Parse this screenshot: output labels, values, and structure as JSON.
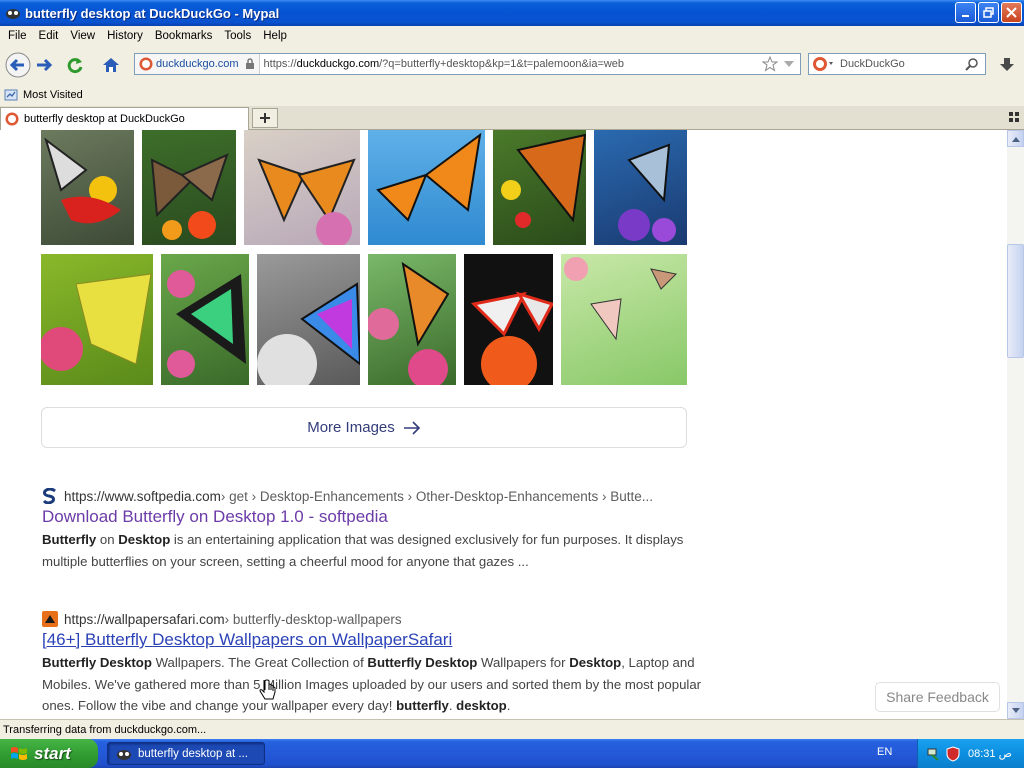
{
  "window": {
    "title": "butterfly desktop at DuckDuckGo - Mypal"
  },
  "menu": {
    "items": [
      {
        "label": "File"
      },
      {
        "label": "Edit"
      },
      {
        "label": "View"
      },
      {
        "label": "History"
      },
      {
        "label": "Bookmarks"
      },
      {
        "label": "Tools"
      },
      {
        "label": "Help"
      }
    ]
  },
  "navbar": {
    "site_domain": "duckduckgo.com",
    "url_scheme": "https://",
    "url_host": "duckduckgo.com",
    "url_rest": "/?q=butterfly+desktop&kp=1&t=palemoon&ia=web",
    "search_placeholder": "DuckDuckGo"
  },
  "bookmarks": {
    "most_visited": "Most Visited"
  },
  "tabs": {
    "active_label": "butterfly desktop at DuckDuckGo"
  },
  "content": {
    "more_images": "More Images",
    "results": [
      {
        "host": "https://www.softpedia.com",
        "path": " › get › Desktop-Enhancements › Other-Desktop-Enhancements › Butte...",
        "title": "Download Butterfly on Desktop 1.0 - softpedia",
        "snippet_b1": "Butterfly",
        "snippet_t1": " on ",
        "snippet_b2": "Desktop",
        "snippet_t2": " is an entertaining application that was designed exclusively for fun purposes. It displays multiple butterflies on your screen, setting a cheerful mood for anyone that gazes ..."
      },
      {
        "host": "https://wallpapersafari.com",
        "path": " › butterfly-desktop-wallpapers",
        "title": "[46+] Butterfly Desktop Wallpapers on WallpaperSafari",
        "s_b1": "Butterfly Desktop",
        "s_t1": " Wallpapers. The Great Collection of ",
        "s_b2": "Butterfly Desktop",
        "s_t2": " Wallpapers for ",
        "s_b3": "Desktop",
        "s_t3": ", Laptop and Mobiles. We've gathered more than 5 Million Images uploaded by our users and sorted them by the most popular ones. Follow the vibe and change your wallpaper every day! ",
        "s_b4": "butterfly",
        "s_t4": ". ",
        "s_b5": "desktop",
        "s_t5": "."
      }
    ],
    "share_feedback": "Share Feedback"
  },
  "status": {
    "text": "Transferring data from duckduckgo.com..."
  },
  "taskbar": {
    "start_label": "start",
    "task_label": "butterfly desktop at ...",
    "lang": "EN",
    "clock": "08:31 ص"
  }
}
